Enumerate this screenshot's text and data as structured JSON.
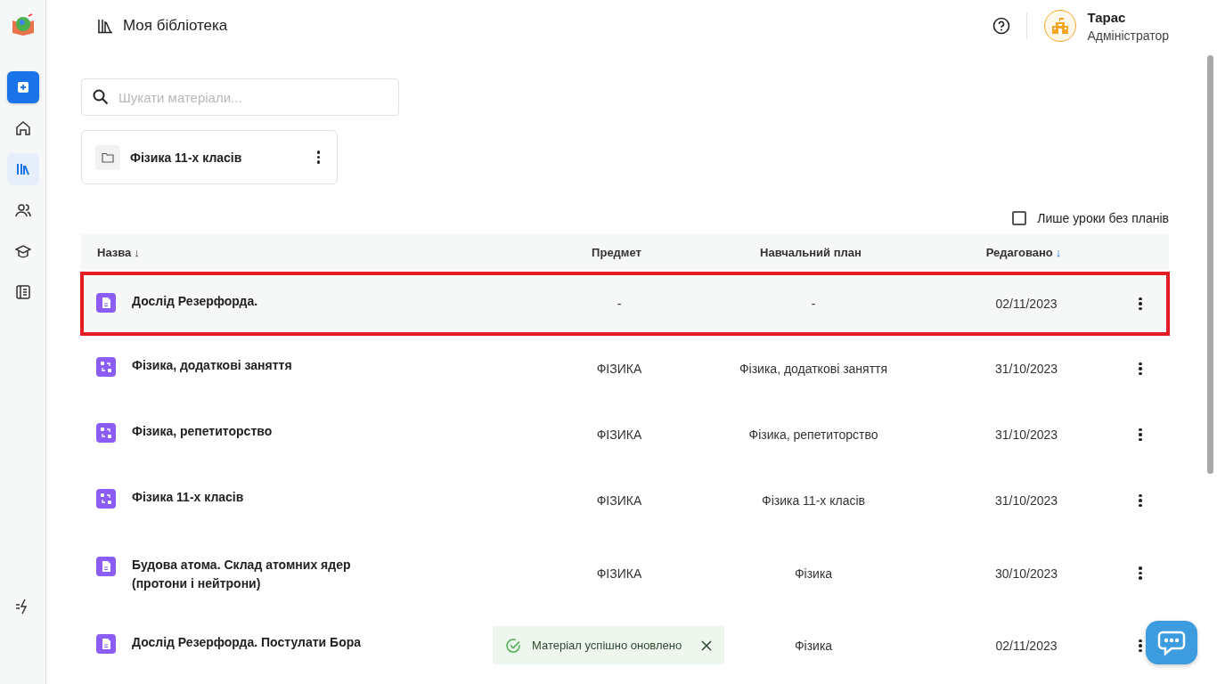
{
  "sidebar": {
    "items": [
      {
        "kind": "create",
        "selected": false
      },
      {
        "kind": "home",
        "selected": false
      },
      {
        "kind": "library",
        "selected": true
      },
      {
        "kind": "people",
        "selected": false
      },
      {
        "kind": "courses",
        "selected": false
      },
      {
        "kind": "journal",
        "selected": false
      }
    ]
  },
  "header": {
    "title": "Моя бібліотека",
    "user": {
      "name": "Тарас",
      "role": "Адміністратор"
    }
  },
  "search": {
    "placeholder": "Шукати матеріали..."
  },
  "folders": [
    {
      "name": "Фізика 11-х класів"
    }
  ],
  "filter": {
    "label": "Лише уроки без планів",
    "checked": false
  },
  "table": {
    "columns": [
      {
        "label": "Назва",
        "sort": "↓",
        "active": false
      },
      {
        "label": "Предмет"
      },
      {
        "label": "Навчальний план"
      },
      {
        "label": "Редаговано",
        "sort": "↓",
        "active": true
      }
    ],
    "rows": [
      {
        "kind": "document",
        "name": "Дослід Резерфорда.",
        "subject": "-",
        "plan": "-",
        "edited": "02/11/2023",
        "highlighted": true
      },
      {
        "kind": "plan",
        "name": "Фізика, додаткові заняття",
        "subject": "ФІЗИКА",
        "plan": "Фізика, додаткові заняття",
        "edited": "31/10/2023",
        "highlighted": false
      },
      {
        "kind": "plan",
        "name": "Фізика, репетиторство",
        "subject": "ФІЗИКА",
        "plan": "Фізика, репетиторство",
        "edited": "31/10/2023",
        "highlighted": false
      },
      {
        "kind": "plan",
        "name": "Фізика 11-х класів",
        "subject": "ФІЗИКА",
        "plan": "Фізика 11-х класів",
        "edited": "31/10/2023",
        "highlighted": false
      },
      {
        "kind": "document",
        "name": "Будова атома. Склад атомних ядер (протони і нейтрони)",
        "subject": "ФІЗИКА",
        "plan": "Фізика",
        "edited": "30/10/2023",
        "highlighted": false
      },
      {
        "kind": "document",
        "name": "Дослід Резерфорда. Постулати Бора",
        "plan": "Фізика",
        "edited": "02/11/2023",
        "highlighted": false
      }
    ]
  },
  "toast": {
    "message": "Матеріал успішно оновлено"
  }
}
